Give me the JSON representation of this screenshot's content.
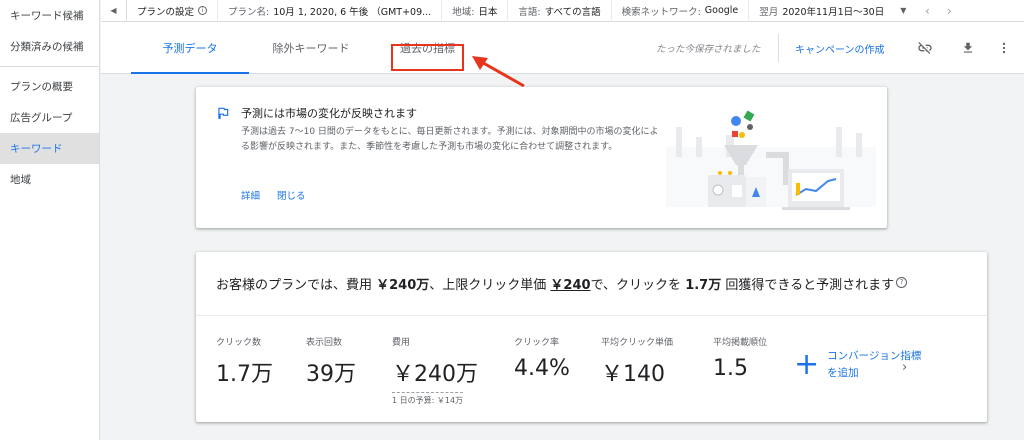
{
  "sidebar": {
    "items": [
      {
        "label": "キーワード候補",
        "active": false
      },
      {
        "label": "分類済みの候補",
        "active": false
      },
      {
        "label": "プランの概要",
        "active": false
      },
      {
        "label": "広告グループ",
        "active": false
      },
      {
        "label": "キーワード",
        "active": true
      },
      {
        "label": "地域",
        "active": false
      }
    ]
  },
  "topbar": {
    "title": "プランの設定",
    "plan_label": "プラン名:",
    "plan_value": "10月 1, 2020, 6 午後 （GMT+09...",
    "region_label": "地域:",
    "region_value": "日本",
    "language_label": "言語:",
    "language_value": "すべての言語",
    "network_label": "検索ネットワーク:",
    "network_value": "Google",
    "period_label": "翌月",
    "period_value": "2020年11月1日〜30日"
  },
  "tabs": {
    "items": [
      "予測データ",
      "除外キーワード",
      "過去の指標"
    ],
    "active_index": 0,
    "highlight_index": 2,
    "saved_text": "たった今保存されました",
    "create_campaign": "キャンペーンの作成"
  },
  "info_card": {
    "title": "予測には市場の変化が反映されます",
    "body": "予測は過去 7〜10 日間のデータをもとに、毎日更新されます。予測には、対象期間中の市場の変化による影響が反映されます。また、季節性を考慮した予測も市場の変化に合わせて調整されます。",
    "link_details": "詳細",
    "link_close": "閉じる"
  },
  "forecast": {
    "s1": "お客様のプランでは、費用 ",
    "cost": "￥240万",
    "s2": "、上限クリック単価 ",
    "cpc": "￥240",
    "s3": "で、クリックを ",
    "clicks": "1.7万",
    "s4": " 回獲得できると予測されます",
    "metrics": [
      {
        "label": "クリック数",
        "value": "1.7万"
      },
      {
        "label": "表示回数",
        "value": "39万"
      },
      {
        "label": "費用",
        "value": "￥240万",
        "sub": "1 日の予算: ￥14万"
      },
      {
        "label": "クリック率",
        "value": "4.4%"
      },
      {
        "label": "平均クリック単価",
        "value": "￥140"
      },
      {
        "label": "平均掲載順位",
        "value": "1.5"
      }
    ],
    "conversion_line1": "コンバージョン指標",
    "conversion_line2": "を追加"
  },
  "colors": {
    "accent": "#1a73e8",
    "highlight": "#e8341c",
    "background": "#f1f3f4"
  }
}
